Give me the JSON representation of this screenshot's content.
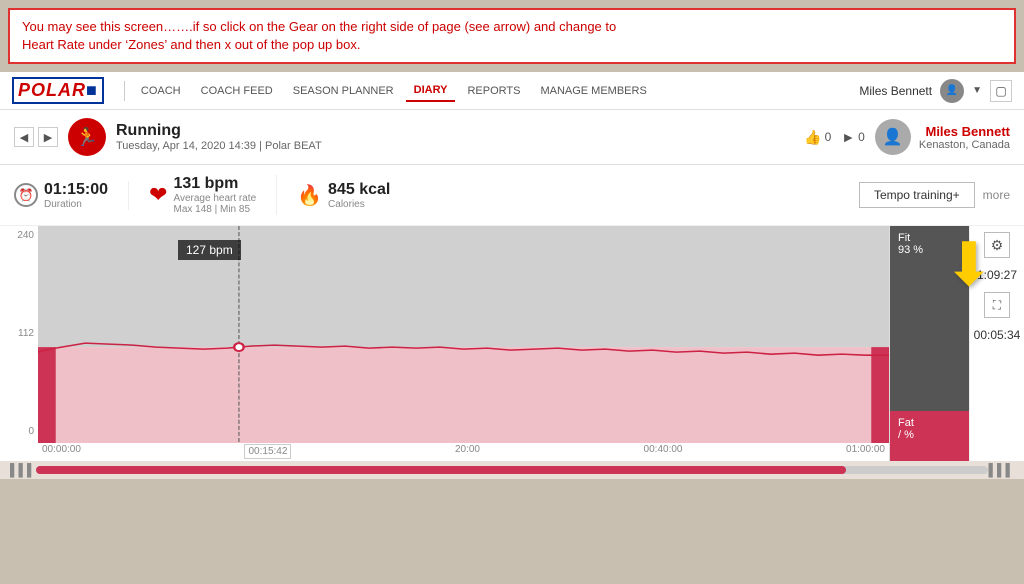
{
  "alert": {
    "text_line1": "You may see this screen…….if so click on the Gear on the right side of page (see arrow) and change to",
    "text_line2": "Heart Rate under ‘Zones’ and then x out of the pop up box."
  },
  "navbar": {
    "logo": "POLAR",
    "links": [
      {
        "label": "COACH",
        "active": false
      },
      {
        "label": "COACH FEED",
        "active": false
      },
      {
        "label": "SEASON PLANNER",
        "active": false
      },
      {
        "label": "DIARY",
        "active": true
      },
      {
        "label": "REPORTS",
        "active": false
      },
      {
        "label": "MANAGE MEMBERS",
        "active": false
      }
    ],
    "user_name": "Miles Bennett",
    "message_icon": "☐"
  },
  "activity": {
    "name": "Running",
    "date": "Tuesday, Apr 14, 2020 14:39 | Polar BEAT",
    "likes": "0",
    "comments": "0",
    "user_name": "Miles Bennett",
    "user_location": "Kenaston, Canada"
  },
  "stats": {
    "duration_label": "Duration",
    "duration_value": "01:15:00",
    "hr_label": "Average heart rate",
    "hr_value": "131 bpm",
    "hr_sub": "Max 148 | Min 85",
    "calories_label": "Calories",
    "calories_value": "845 kcal",
    "tempo_btn": "Tempo training+",
    "more_link": "more"
  },
  "chart": {
    "y_labels": [
      "240",
      "112",
      "0"
    ],
    "x_labels": [
      "00:00:00",
      "00:15:42",
      "20:00",
      "00:40:00",
      "01:00:00"
    ],
    "tooltip": "127 bpm",
    "zone_fit_label": "Fit",
    "zone_fit_pct": "93 %",
    "zone_fat_label": "Fat",
    "zone_fat_pct": "/ %",
    "time_top": "1:09:27",
    "time_bottom": "00:05:34"
  },
  "icons": {
    "run": "🏃",
    "heart": "♥",
    "fire": "🔥",
    "gear": "⚙",
    "expand": "⛶",
    "thumb": "👍",
    "comment": "💬",
    "left_arrow": "◄",
    "right_arrow": "►"
  }
}
